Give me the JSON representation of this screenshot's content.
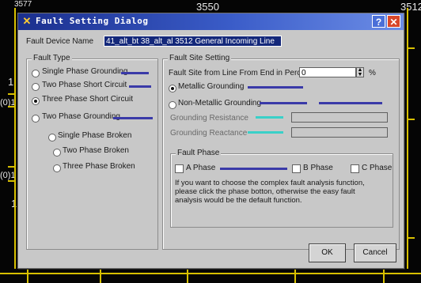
{
  "background": {
    "labels": {
      "top_left": "3577",
      "top_center": "3550",
      "top_right": "3512",
      "left_1": "1",
      "left_2": "(0)1",
      "left_3": "(0)1",
      "left_4": "1"
    },
    "line_color": "#d8c000"
  },
  "dialog": {
    "title": "Fault Setting Dialog",
    "title_icon": "lightning-icon",
    "help_label": "?",
    "close_label": "✕",
    "fault_device_label": "Fault Device Name",
    "fault_device_value": "41_alt_bt 38_alt_al 3512 General Incoming Line",
    "fault_type": {
      "title": "Fault Type",
      "options": [
        {
          "label": "Single Phase Grounding",
          "checked": false
        },
        {
          "label": "Two Phase Short Circuit",
          "checked": false
        },
        {
          "label": "Three Phase Short Circuit",
          "checked": true
        },
        {
          "label": "Two Phase Grounding",
          "checked": false
        },
        {
          "label": "Single Phase Broken",
          "checked": false
        },
        {
          "label": "Two Phase Broken",
          "checked": false
        },
        {
          "label": "Three Phase Broken",
          "checked": false
        }
      ]
    },
    "fault_site": {
      "title": "Fault Site Setting",
      "percent_label": "Fault Site from Line From End in Percent",
      "percent_value": "0",
      "percent_unit": "%",
      "grounding_options": [
        {
          "label": "Metallic Grounding",
          "checked": true
        },
        {
          "label": "Non-Metallic Grounding",
          "checked": false
        }
      ],
      "resistance_label": "Grounding Resistance",
      "reactance_label": "Grounding Reactance"
    },
    "fault_phase": {
      "title": "Fault Phase",
      "phases": [
        {
          "label": "A Phase",
          "checked": false
        },
        {
          "label": "B Phase",
          "checked": false
        },
        {
          "label": "C Phase",
          "checked": false
        }
      ],
      "info_lines": [
        "If you want to choose the complex fault analysis function,",
        "please click the phase botton, otherwise the easy fault",
        "analysis would be the default function."
      ]
    },
    "ok_label": "OK",
    "cancel_label": "Cancel"
  }
}
